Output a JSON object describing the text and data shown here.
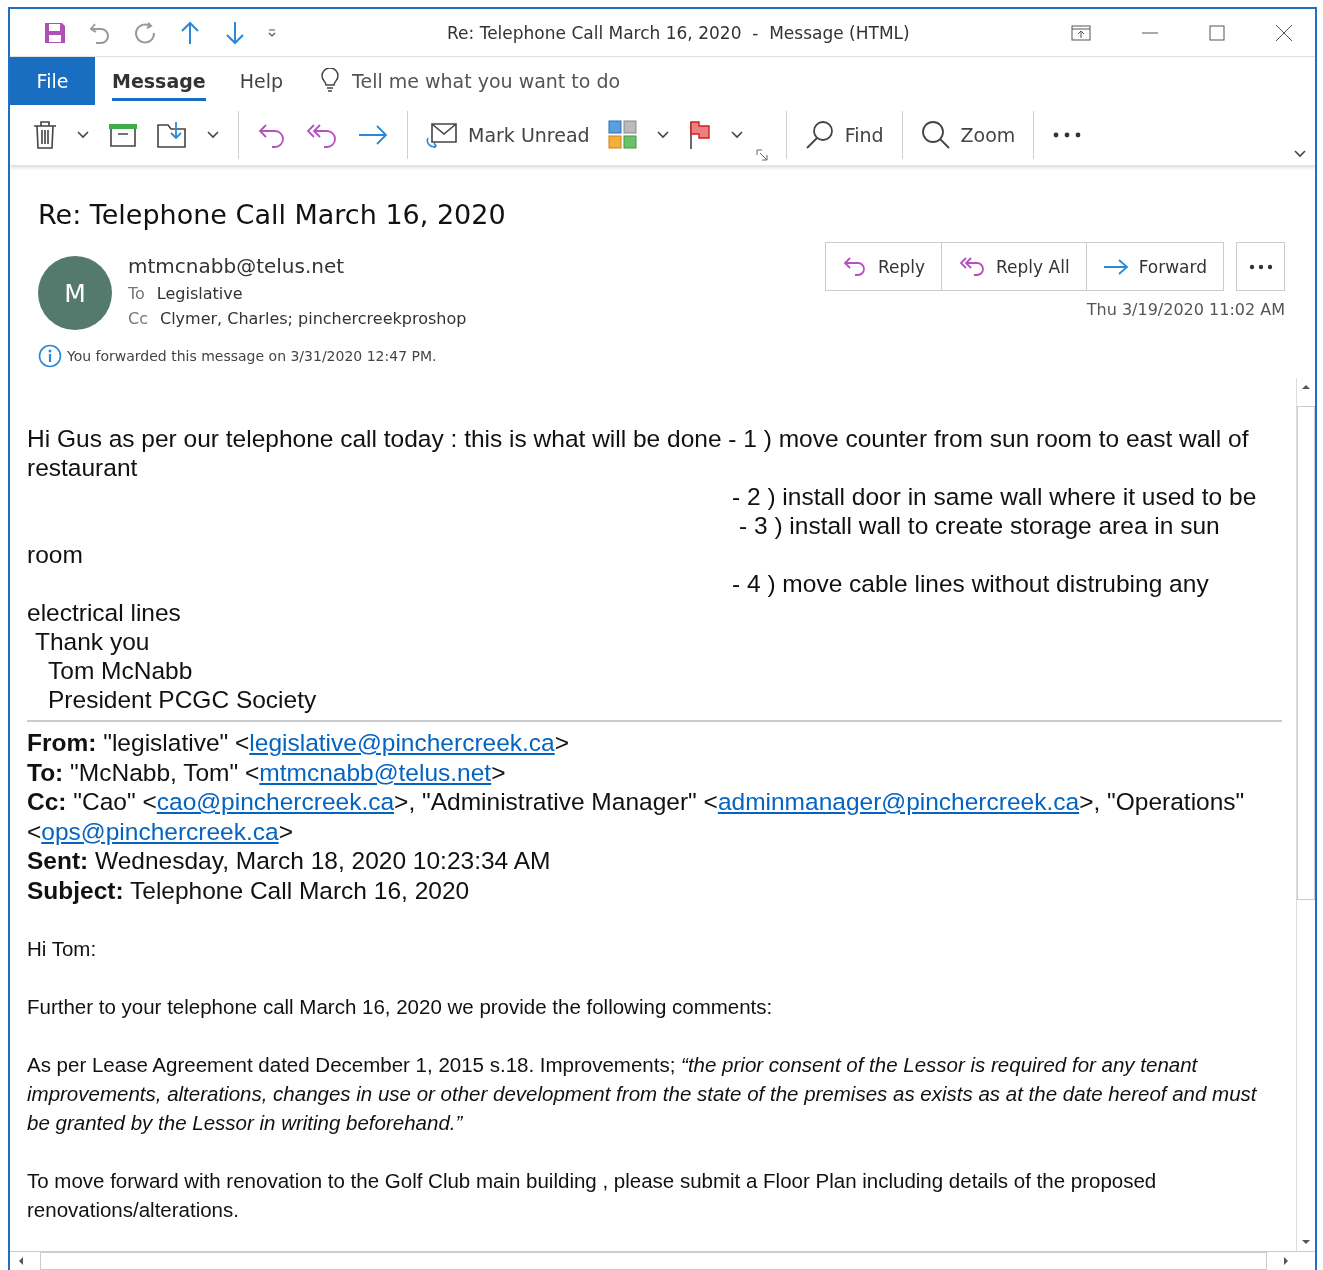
{
  "window": {
    "title": "Re: Telephone Call March 16, 2020  -  Message (HTML)"
  },
  "ribbon": {
    "tabs": [
      {
        "label": "File",
        "kind": "file",
        "selected": false
      },
      {
        "label": "Message",
        "kind": "tab",
        "selected": true
      },
      {
        "label": "Help",
        "kind": "tab",
        "selected": false
      }
    ],
    "search": {
      "placeholder": "Tell me what you want to do"
    }
  },
  "toolbar": {
    "mark_unread": "Mark Unread",
    "find": "Find",
    "zoom": "Zoom"
  },
  "message": {
    "subject": "Re: Telephone Call March 16, 2020",
    "initial": "M",
    "sender": "mtmcnabb@telus.net",
    "to_label": "To",
    "to": "Legislative",
    "cc_label": "Cc",
    "cc": "Clymer, Charles; pinchercreekproshop",
    "info": "You forwarded this message on 3/31/2020 12:47 PM.",
    "actions": [
      "Reply",
      "Reply All",
      "Forward"
    ],
    "date": "Thu 3/19/2020 11:02 AM"
  },
  "body": {
    "lines": [
      {
        "kind": "plain",
        "text": "Hi Gus as per our telephone call today : this is what will be done - 1 ) move counter from sun room to  east wall of restaurant"
      },
      {
        "kind": "step",
        "text": "- 2 ) install door in same wall where it used to be"
      },
      {
        "kind": "step2",
        "text": "- 3 ) install wall to create storage area in sun"
      },
      {
        "kind": "plain",
        "text": "room"
      },
      {
        "kind": "step",
        "text": "- 4 ) move cable lines without distrubing any"
      },
      {
        "kind": "plain",
        "text": "electrical lines"
      },
      {
        "kind": "signoff",
        "text": "Thank you"
      },
      {
        "kind": "signature",
        "text": "Tom McNabb"
      },
      {
        "kind": "signature",
        "text": "President PCGC Society"
      }
    ],
    "header_fields": [
      {
        "label": "From:",
        "parts": [
          {
            "kind": "text",
            "text": "\"legislative\" <"
          },
          {
            "kind": "link",
            "text": "legislative@pinchercreek.ca"
          },
          {
            "kind": "text",
            "text": ">"
          }
        ]
      },
      {
        "label": "To:",
        "parts": [
          {
            "kind": "text",
            "text": "\"McNabb, Tom\" <"
          },
          {
            "kind": "link",
            "text": "mtmcnabb@telus.net"
          },
          {
            "kind": "text",
            "text": ">"
          }
        ]
      },
      {
        "label": "Cc:",
        "parts": [
          {
            "kind": "text",
            "text": "\"Cao\" <"
          },
          {
            "kind": "link",
            "text": "cao@pinchercreek.ca"
          },
          {
            "kind": "text",
            "text": ">, \"Administrative Manager\" <"
          },
          {
            "kind": "link",
            "text": "adminmanager@pinchercreek.ca"
          },
          {
            "kind": "text",
            "text": ">, \"Operations\" <"
          },
          {
            "kind": "link",
            "text": "ops@pinchercreek.ca"
          },
          {
            "kind": "text",
            "text": ">"
          }
        ]
      },
      {
        "label": "Sent:",
        "parts": [
          {
            "kind": "text",
            "text": "Wednesday, March 18, 2020 10:23:34 AM"
          }
        ]
      },
      {
        "label": "Subject:",
        "parts": [
          {
            "kind": "text",
            "text": "Telephone Call March 16, 2020"
          }
        ]
      }
    ],
    "paragraphs": [
      "Hi Tom:",
      "Further to your telephone call March 16, 2020 we provide the following comments:",
      "As per Lease Agreement dated December 1, 2015 s.18. Improvements; *“the prior consent of the Lessor is required for any tenant improvements, alterations, changes in use or other development from the state of the premises as exists as at the date hereof and must be granted by the Lessor in writing beforehand.”*",
      "To move forward with renovation to the Golf Club main building , please submit a Floor Plan including details of the proposed renovations/alterations."
    ]
  }
}
